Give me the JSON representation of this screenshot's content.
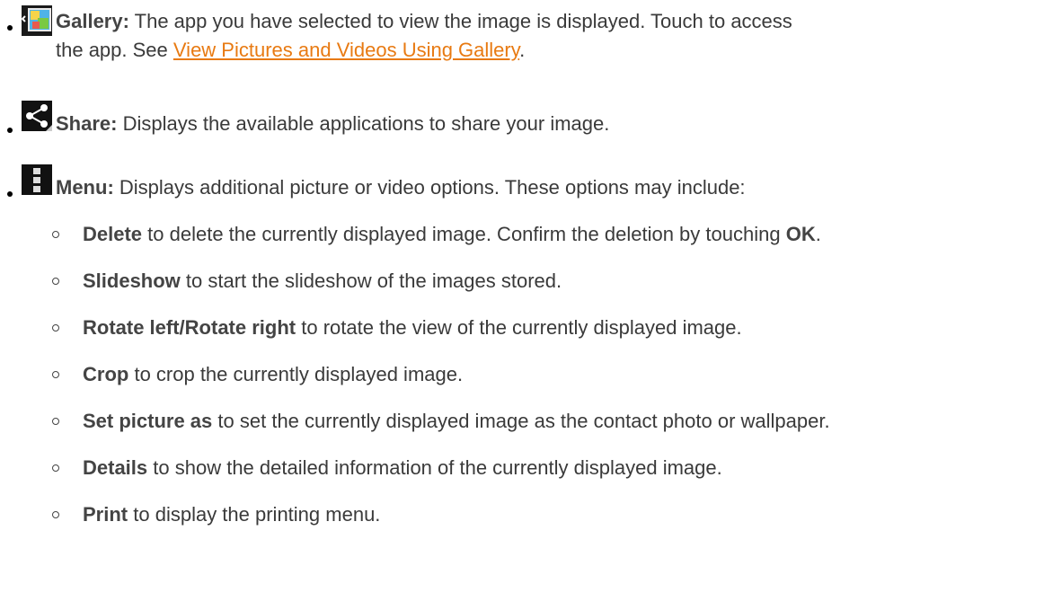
{
  "gallery": {
    "icon": "gallery-app-icon",
    "label": "Gallery:",
    "text_line1": "The app you have selected to view the image is displayed. Touch to access",
    "text_line2": "the app. See",
    "link": "View Pictures and Videos Using Gallery",
    "end": "."
  },
  "share": {
    "icon": "share-icon",
    "label": "Share:",
    "text": "Displays the available applications to share your image."
  },
  "menu": {
    "icon": "menu-icon",
    "label": "Menu:",
    "text": "Displays additional picture or video options. These options may include:",
    "options": [
      {
        "label": "Delete",
        "text": "to delete the currently displayed image. Confirm the deletion by touching",
        "extra": "OK",
        "end": "."
      },
      {
        "label": "Slideshow",
        "text": "to start the slideshow of the images stored."
      },
      {
        "label": "Rotate left/Rotate right",
        "text": "to rotate the view of the currently displayed image."
      },
      {
        "label": "Crop",
        "text": "to crop the currently displayed image."
      },
      {
        "label": "Set picture as",
        "text": "to set the currently displayed image as the contact photo or wallpaper."
      },
      {
        "label": "Details",
        "text": "to show the detailed information of the currently displayed image."
      },
      {
        "label": "Print",
        "text": "to display the printing menu."
      }
    ]
  },
  "colors": {
    "link": "#e87a12",
    "text": "#3a3a3a"
  }
}
